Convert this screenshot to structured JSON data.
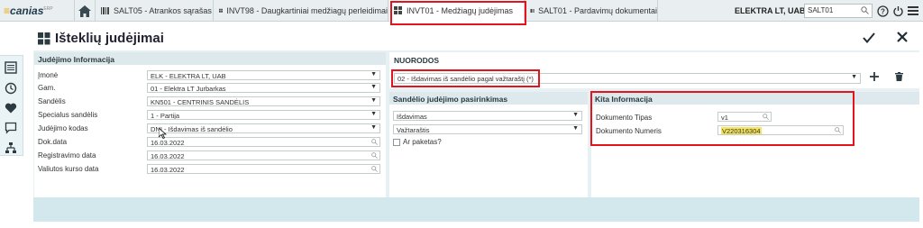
{
  "topbar": {
    "logo_main": "canias",
    "logo_sup": "ERP",
    "tabs": [
      {
        "label": "SALT05 - Atrankos sąrašas",
        "icon": "barcode-icon"
      },
      {
        "label": "INVT98 - Daugkartiniai medžiagų perleidimai",
        "icon": "boxes-icon"
      },
      {
        "label": "INVT01 - Medžiagų judėjimas",
        "icon": "boxes-icon"
      },
      {
        "label": "SALT01 - Pardavimų dokumentai",
        "icon": "barcode-icon"
      }
    ],
    "company": "ELEKTRA LT, UAB",
    "company_code": "SALT01"
  },
  "title": "Išteklių judėjimai",
  "left_panel": {
    "header": "Judėjimo Informacija",
    "fields": [
      {
        "label": "Įmonė",
        "value": "ELK - ELEKTRA LT, UAB",
        "kind": "select"
      },
      {
        "label": "Gam.",
        "value": "01 - Elektra LT Jurbarkas",
        "kind": "select"
      },
      {
        "label": "Sandėlis",
        "value": "KN501 - CENTRINIS SANDĖLIS",
        "kind": "select"
      },
      {
        "label": "Specialus sandėlis",
        "value": "1 - Partija",
        "kind": "select"
      },
      {
        "label": "Judėjimo kodas",
        "value": "DNI - Išdavimas iš sandėlio",
        "kind": "select"
      },
      {
        "label": "Dok.data",
        "value": "16.03.2022",
        "kind": "search"
      },
      {
        "label": "Registravimo data",
        "value": "16.03.2022",
        "kind": "search"
      },
      {
        "label": "Valiutos kurso data",
        "value": "16.03.2022",
        "kind": "search"
      }
    ]
  },
  "nuorodos": {
    "header": "NUORODOS",
    "value": "02 - Išdavimas iš sandėlio pagal važtaraštį (*)"
  },
  "middle_panel": {
    "header": "Sandėlio judėjimo pasirinkimas",
    "select1": "Išdavimas",
    "select2": "Važtaraštis",
    "checkbox_label": "Ar paketas?"
  },
  "right_panel": {
    "header": "Kita Informacija",
    "doc_type_label": "Dokumento Tipas",
    "doc_type_value": "v1",
    "doc_number_label": "Dokumento Numeris",
    "doc_number_value": "V220316304"
  },
  "colors": {
    "highlight_red": "#e3141b",
    "panel_header": "#dde9ec",
    "bottom_bar": "#d2e8ec",
    "value_highlight": "#f5e45c"
  }
}
